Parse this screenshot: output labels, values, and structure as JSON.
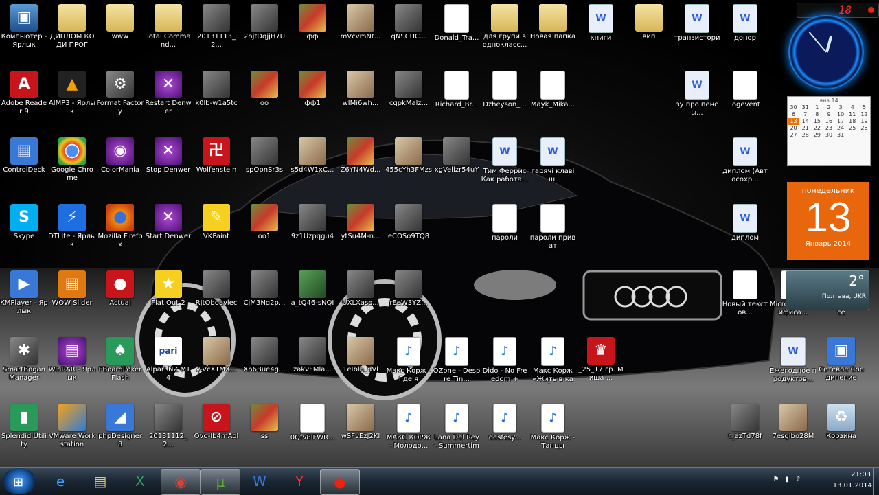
{
  "desktop": {
    "icons": [
      {
        "label": "Компьютер - Ярлык",
        "kind": "pc",
        "glyph": "▣",
        "shortcut": true,
        "col": 0,
        "row": 0
      },
      {
        "label": "ДИПЛОМ КОДИ ПРОГ",
        "kind": "folder",
        "glyph": "",
        "shortcut": false,
        "col": 1,
        "row": 0
      },
      {
        "label": "www",
        "kind": "folder",
        "glyph": "",
        "shortcut": false,
        "col": 2,
        "row": 0
      },
      {
        "label": "Total Command...",
        "kind": "folder",
        "glyph": "",
        "shortcut": false,
        "col": 3,
        "row": 0
      },
      {
        "label": "20131113_2...",
        "kind": "img2",
        "glyph": "",
        "shortcut": false,
        "col": 4,
        "row": 0
      },
      {
        "label": "2njtDqjjH7U",
        "kind": "img2",
        "glyph": "",
        "shortcut": false,
        "col": 5,
        "row": 0
      },
      {
        "label": "фф",
        "kind": "img1",
        "glyph": "",
        "shortcut": false,
        "col": 6,
        "row": 0
      },
      {
        "label": "mVcvmNt...",
        "kind": "img3",
        "glyph": "",
        "shortcut": false,
        "col": 7,
        "row": 0
      },
      {
        "label": "qNSCUC...",
        "kind": "img2",
        "glyph": "",
        "shortcut": false,
        "col": 8,
        "row": 0
      },
      {
        "label": "Donald_Tra...",
        "kind": "doc",
        "glyph": "",
        "shortcut": false,
        "col": 9,
        "row": 0
      },
      {
        "label": "для групи в однокласс...",
        "kind": "folder",
        "glyph": "",
        "shortcut": false,
        "col": 10,
        "row": 0
      },
      {
        "label": "Новая папка",
        "kind": "folder",
        "glyph": "",
        "shortcut": false,
        "col": 11,
        "row": 0
      },
      {
        "label": "книги",
        "kind": "word",
        "glyph": "W",
        "shortcut": false,
        "col": 12,
        "row": 0
      },
      {
        "label": "вип",
        "kind": "folder",
        "glyph": "",
        "shortcut": false,
        "col": 13,
        "row": 0
      },
      {
        "label": "транзистори",
        "kind": "word",
        "glyph": "W",
        "shortcut": false,
        "col": 14,
        "row": 0
      },
      {
        "label": "донор",
        "kind": "word",
        "glyph": "W",
        "shortcut": false,
        "col": 15,
        "row": 0
      },
      {
        "label": "Adobe Reader 9",
        "kind": "red",
        "glyph": "A",
        "shortcut": true,
        "col": 0,
        "row": 1
      },
      {
        "label": "AIMP3 - Ярлык",
        "kind": "aimp",
        "glyph": "▲",
        "shortcut": true,
        "col": 1,
        "row": 1
      },
      {
        "label": "Format Factory",
        "kind": "img2",
        "glyph": "⚙",
        "shortcut": true,
        "col": 2,
        "row": 1
      },
      {
        "label": "Restart Denwer",
        "kind": "purple",
        "glyph": "✕",
        "shortcut": true,
        "col": 3,
        "row": 1
      },
      {
        "label": "k0lb-w1a5tc",
        "kind": "img2",
        "glyph": "",
        "shortcut": false,
        "col": 4,
        "row": 1
      },
      {
        "label": "oo",
        "kind": "img1",
        "glyph": "",
        "shortcut": false,
        "col": 5,
        "row": 1
      },
      {
        "label": "фф1",
        "kind": "img1",
        "glyph": "",
        "shortcut": false,
        "col": 6,
        "row": 1
      },
      {
        "label": "wlMi6wh...",
        "kind": "img3",
        "glyph": "",
        "shortcut": false,
        "col": 7,
        "row": 1
      },
      {
        "label": "cqpkMalz...",
        "kind": "img2",
        "glyph": "",
        "shortcut": false,
        "col": 8,
        "row": 1
      },
      {
        "label": "Richard_Br...",
        "kind": "doc",
        "glyph": "",
        "shortcut": false,
        "col": 9,
        "row": 1
      },
      {
        "label": "Dzheyson_...",
        "kind": "doc",
        "glyph": "",
        "shortcut": false,
        "col": 10,
        "row": 1
      },
      {
        "label": "Mayk_Mika...",
        "kind": "doc",
        "glyph": "",
        "shortcut": false,
        "col": 11,
        "row": 1
      },
      {
        "label": "зу про пенсы...",
        "kind": "word",
        "glyph": "W",
        "shortcut": false,
        "col": 14,
        "row": 1
      },
      {
        "label": "logevent",
        "kind": "doc",
        "glyph": "",
        "shortcut": false,
        "col": 15,
        "row": 1
      },
      {
        "label": "ControlDeck",
        "kind": "blue",
        "glyph": "▦",
        "shortcut": true,
        "col": 0,
        "row": 2
      },
      {
        "label": "Google Chrome",
        "kind": "chrome",
        "glyph": "",
        "shortcut": true,
        "col": 1,
        "row": 2
      },
      {
        "label": "ColorMania",
        "kind": "purple",
        "glyph": "◉",
        "shortcut": true,
        "col": 2,
        "row": 2
      },
      {
        "label": "Stop Denwer",
        "kind": "purple",
        "glyph": "✕",
        "shortcut": true,
        "col": 3,
        "row": 2
      },
      {
        "label": "Wolfenstein",
        "kind": "red",
        "glyph": "卍",
        "shortcut": true,
        "col": 4,
        "row": 2
      },
      {
        "label": "spOpnSr3s",
        "kind": "img2",
        "glyph": "",
        "shortcut": false,
        "col": 5,
        "row": 2
      },
      {
        "label": "s5d4W1xC...",
        "kind": "img3",
        "glyph": "",
        "shortcut": false,
        "col": 6,
        "row": 2
      },
      {
        "label": "Z6YN4Wd...",
        "kind": "img1",
        "glyph": "",
        "shortcut": false,
        "col": 7,
        "row": 2
      },
      {
        "label": "455cYh3FMzs",
        "kind": "img3",
        "glyph": "",
        "shortcut": false,
        "col": 8,
        "row": 2
      },
      {
        "label": "xgVellzr54uY",
        "kind": "img2",
        "glyph": "",
        "shortcut": false,
        "col": 9,
        "row": 2
      },
      {
        "label": "Тим Феррис Как работа...",
        "kind": "word",
        "glyph": "W",
        "shortcut": false,
        "col": 10,
        "row": 2
      },
      {
        "label": "гарячі клавіші",
        "kind": "word",
        "glyph": "W",
        "shortcut": false,
        "col": 11,
        "row": 2
      },
      {
        "label": "диплом (Автосохр...",
        "kind": "word",
        "glyph": "W",
        "shortcut": false,
        "col": 15,
        "row": 2
      },
      {
        "label": "Skype",
        "kind": "skype",
        "glyph": "S",
        "shortcut": true,
        "col": 0,
        "row": 3
      },
      {
        "label": "DTLite - Ярлык",
        "kind": "dtlite",
        "glyph": "⚡",
        "shortcut": true,
        "col": 1,
        "row": 3
      },
      {
        "label": "Mozilla Firefox",
        "kind": "firefox",
        "glyph": "",
        "shortcut": true,
        "col": 2,
        "row": 3
      },
      {
        "label": "Start Denwer",
        "kind": "purple",
        "glyph": "✕",
        "shortcut": true,
        "col": 3,
        "row": 3
      },
      {
        "label": "VKPaint",
        "kind": "yellow",
        "glyph": "✎",
        "shortcut": true,
        "col": 4,
        "row": 3
      },
      {
        "label": "oo1",
        "kind": "img1",
        "glyph": "",
        "shortcut": false,
        "col": 5,
        "row": 3
      },
      {
        "label": "9z1Uzpqgu4",
        "kind": "img2",
        "glyph": "",
        "shortcut": false,
        "col": 6,
        "row": 3
      },
      {
        "label": "ytSu4M-n...",
        "kind": "img1",
        "glyph": "",
        "shortcut": false,
        "col": 7,
        "row": 3
      },
      {
        "label": "eCOSo9TQ8",
        "kind": "img2",
        "glyph": "",
        "shortcut": false,
        "col": 8,
        "row": 3
      },
      {
        "label": "пароли",
        "kind": "doc",
        "glyph": "",
        "shortcut": false,
        "col": 10,
        "row": 3
      },
      {
        "label": "пароли приват",
        "kind": "doc",
        "glyph": "",
        "shortcut": false,
        "col": 11,
        "row": 3
      },
      {
        "label": "диплом",
        "kind": "word",
        "glyph": "W",
        "shortcut": false,
        "col": 15,
        "row": 3
      },
      {
        "label": "KMPlayer - Ярлык",
        "kind": "blue",
        "glyph": "▶",
        "shortcut": true,
        "col": 0,
        "row": 4
      },
      {
        "label": "WOW Slider",
        "kind": "orange",
        "glyph": "▦",
        "shortcut": true,
        "col": 1,
        "row": 4
      },
      {
        "label": "Actual",
        "kind": "red",
        "glyph": "●",
        "shortcut": true,
        "col": 2,
        "row": 4
      },
      {
        "label": "Flat Out 2",
        "kind": "yellow",
        "glyph": "★",
        "shortcut": true,
        "col": 3,
        "row": 4
      },
      {
        "label": "RJtOboavlec",
        "kind": "img2",
        "glyph": "",
        "shortcut": false,
        "col": 4,
        "row": 4
      },
      {
        "label": "CjM3Ng2p...",
        "kind": "img2",
        "glyph": "",
        "shortcut": false,
        "col": 5,
        "row": 4
      },
      {
        "label": "a_tQ46-sNQI",
        "kind": "img4",
        "glyph": "",
        "shortcut": false,
        "col": 6,
        "row": 4
      },
      {
        "label": "UXLXaso...",
        "kind": "img2",
        "glyph": "",
        "shortcut": false,
        "col": 7,
        "row": 4
      },
      {
        "label": "rEeW3YZ...",
        "kind": "img2",
        "glyph": "",
        "shortcut": false,
        "col": 8,
        "row": 4
      },
      {
        "label": "Новый текстов...",
        "kind": "doc",
        "glyph": "",
        "shortcut": false,
        "col": 15,
        "row": 4
      },
      {
        "label": "Microsoft Калифиса...",
        "kind": "doc",
        "glyph": "",
        "shortcut": false,
        "col": 16,
        "row": 4
      },
      {
        "label": "Microsoft Office",
        "kind": "doc",
        "glyph": "",
        "shortcut": false,
        "col": 17,
        "row": 4
      },
      {
        "label": "SmartBogan Manager",
        "kind": "img2",
        "glyph": "✱",
        "shortcut": true,
        "col": 0,
        "row": 5
      },
      {
        "label": "WinRAR - Ярлык",
        "kind": "purple",
        "glyph": "▤",
        "shortcut": true,
        "col": 1,
        "row": 5
      },
      {
        "label": "FBoardPoker Flash",
        "kind": "green",
        "glyph": "♠",
        "shortcut": true,
        "col": 2,
        "row": 5
      },
      {
        "label": "Alpari NZ MT4",
        "kind": "pari",
        "glyph": "pari",
        "shortcut": true,
        "col": 3,
        "row": 5
      },
      {
        "label": "y-VcXTMX...",
        "kind": "img3",
        "glyph": "",
        "shortcut": false,
        "col": 4,
        "row": 5
      },
      {
        "label": "Xh6Bue4g...",
        "kind": "img2",
        "glyph": "",
        "shortcut": false,
        "col": 5,
        "row": 5
      },
      {
        "label": "zakvFMla...",
        "kind": "img2",
        "glyph": "",
        "shortcut": false,
        "col": 6,
        "row": 5
      },
      {
        "label": "1eIblh_dVl",
        "kind": "img3",
        "glyph": "",
        "shortcut": false,
        "col": 7,
        "row": 5
      },
      {
        "label": "Макс Корж - Где я",
        "kind": "mp3",
        "glyph": "♪",
        "shortcut": false,
        "col": 8,
        "row": 5
      },
      {
        "label": "OZone - Despre Tin...",
        "kind": "mp3",
        "glyph": "♪",
        "shortcut": false,
        "col": 9,
        "row": 5
      },
      {
        "label": "Dido - No Freedom +",
        "kind": "mp3",
        "glyph": "♪",
        "shortcut": false,
        "col": 10,
        "row": 5
      },
      {
        "label": "Макс Корж «Жить в кай...",
        "kind": "mp3",
        "glyph": "♪",
        "shortcut": false,
        "col": 11,
        "row": 5
      },
      {
        "label": "_25_17 гр. Миша ...",
        "kind": "red",
        "glyph": "♛",
        "shortcut": false,
        "col": 12,
        "row": 5
      },
      {
        "label": "Ежегодное продуктов...",
        "kind": "word",
        "glyph": "W",
        "shortcut": false,
        "col": 16,
        "row": 5
      },
      {
        "label": "Сетевое Соединение",
        "kind": "blue",
        "glyph": "▣",
        "shortcut": true,
        "col": 17,
        "row": 5
      },
      {
        "label": "Splendid Utility",
        "kind": "green",
        "glyph": "▮",
        "shortcut": true,
        "col": 0,
        "row": 6
      },
      {
        "label": "VMware Workstation",
        "kind": "vm",
        "glyph": "",
        "shortcut": true,
        "col": 1,
        "row": 6
      },
      {
        "label": "phpDesigner 8",
        "kind": "blue",
        "glyph": "◢",
        "shortcut": true,
        "col": 2,
        "row": 6
      },
      {
        "label": "20131112_2...",
        "kind": "img2",
        "glyph": "",
        "shortcut": false,
        "col": 3,
        "row": 6
      },
      {
        "label": "Ovo-lb4mAoI",
        "kind": "red",
        "glyph": "⊘",
        "shortcut": false,
        "col": 4,
        "row": 6
      },
      {
        "label": "ss",
        "kind": "img1",
        "glyph": "",
        "shortcut": false,
        "col": 5,
        "row": 6
      },
      {
        "label": "0Qfv8lFWR...",
        "kind": "doc",
        "glyph": "",
        "shortcut": false,
        "col": 6,
        "row": 6
      },
      {
        "label": "wSFvEzJ2KI",
        "kind": "img3",
        "glyph": "",
        "shortcut": false,
        "col": 7,
        "row": 6
      },
      {
        "label": "МАКС КОРЖ - Молодо...",
        "kind": "mp3",
        "glyph": "♪",
        "shortcut": false,
        "col": 8,
        "row": 6
      },
      {
        "label": "Lana Del Rey - Summertime...",
        "kind": "mp3",
        "glyph": "♪",
        "shortcut": false,
        "col": 9,
        "row": 6
      },
      {
        "label": "desfesy...",
        "kind": "mp3",
        "glyph": "♪",
        "shortcut": false,
        "col": 10,
        "row": 6
      },
      {
        "label": "Макс Корж - Танцы",
        "kind": "mp3",
        "glyph": "♪",
        "shortcut": false,
        "col": 11,
        "row": 6
      },
      {
        "label": "r_azTd78f",
        "kind": "img2",
        "glyph": "",
        "shortcut": false,
        "col": 15,
        "row": 6
      },
      {
        "label": "7esgibo28M",
        "kind": "img3",
        "glyph": "",
        "shortcut": false,
        "col": 16,
        "row": 6
      },
      {
        "label": "Корзина",
        "kind": "bin",
        "glyph": "♻",
        "shortcut": false,
        "col": 17,
        "row": 6
      }
    ]
  },
  "gadgets": {
    "led_value": "18",
    "calendar_mini": {
      "header": "янв 14",
      "weeks": [
        [
          "30",
          "31",
          "1",
          "2",
          "3",
          "4",
          "5"
        ],
        [
          "6",
          "7",
          "8",
          "9",
          "10",
          "11",
          "12"
        ],
        [
          "13",
          "14",
          "15",
          "16",
          "17",
          "18",
          "19"
        ],
        [
          "20",
          "21",
          "22",
          "23",
          "24",
          "25",
          "26"
        ],
        [
          "27",
          "28",
          "29",
          "30",
          "31",
          "",
          ""
        ]
      ],
      "today": "13"
    },
    "calendar_big": {
      "weekday": "понедельник",
      "day": "13",
      "month_year": "Январь 2014"
    },
    "weather": {
      "temperature": "2°",
      "city": "Полтава, UKR"
    }
  },
  "taskbar": {
    "buttons": [
      {
        "name": "internet-explorer",
        "glyph": "e",
        "color": "#3fa0ff",
        "active": false
      },
      {
        "name": "windows-explorer",
        "glyph": "▤",
        "color": "#f2c94c",
        "active": false
      },
      {
        "name": "excel",
        "glyph": "X",
        "color": "#2f9e5a",
        "active": false
      },
      {
        "name": "google-chrome",
        "glyph": "◉",
        "color": "#e0402f",
        "active": true
      },
      {
        "name": "utorrent",
        "glyph": "μ",
        "color": "#59b02b",
        "active": true
      },
      {
        "name": "word",
        "glyph": "W",
        "color": "#3a78d8",
        "active": false
      },
      {
        "name": "yandex-browser",
        "glyph": "Y",
        "color": "#ff2a2a",
        "active": false
      },
      {
        "name": "recorder",
        "glyph": "●",
        "color": "#e21",
        "active": true
      }
    ],
    "clock": {
      "time": "21:03",
      "date": "13.01.2014"
    }
  },
  "colors": {
    "calendar_accent": "#e8660c",
    "clock_glow": "#1a8cff"
  }
}
